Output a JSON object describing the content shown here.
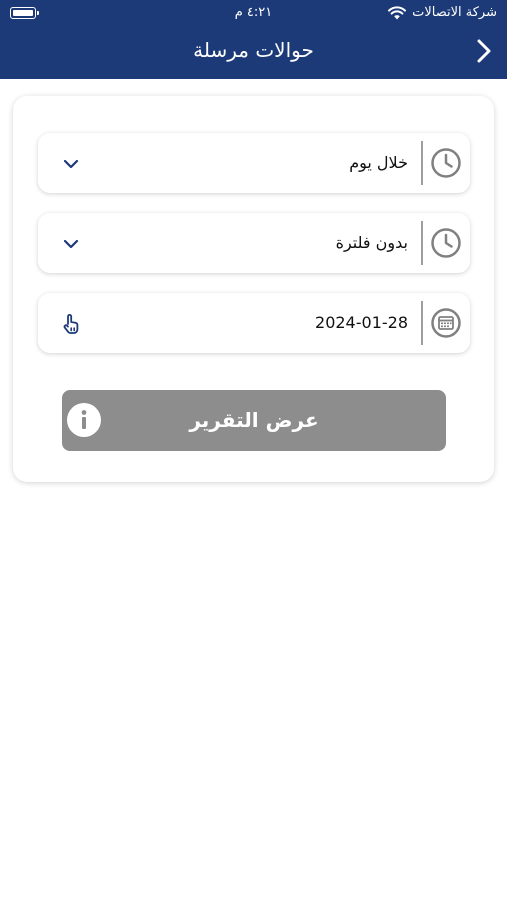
{
  "status_bar": {
    "carrier": "شركة الاتصالات",
    "time": "٤:٢١ م"
  },
  "header": {
    "title": "حوالات مرسلة",
    "background_color": "#1c3a78"
  },
  "filters": {
    "period": {
      "value": "خلال يوم",
      "icon": "clock-icon",
      "control_icon": "chevron-down-icon"
    },
    "range": {
      "value": "بدون فلترة",
      "icon": "clock-icon",
      "control_icon": "chevron-down-icon"
    },
    "date": {
      "value": "2024-01-28",
      "icon": "calendar-icon",
      "control_icon": "tap-hand-icon"
    }
  },
  "report_button": {
    "label": "عرض التقرير",
    "icon": "info-icon",
    "color": "#8d8d8d"
  }
}
